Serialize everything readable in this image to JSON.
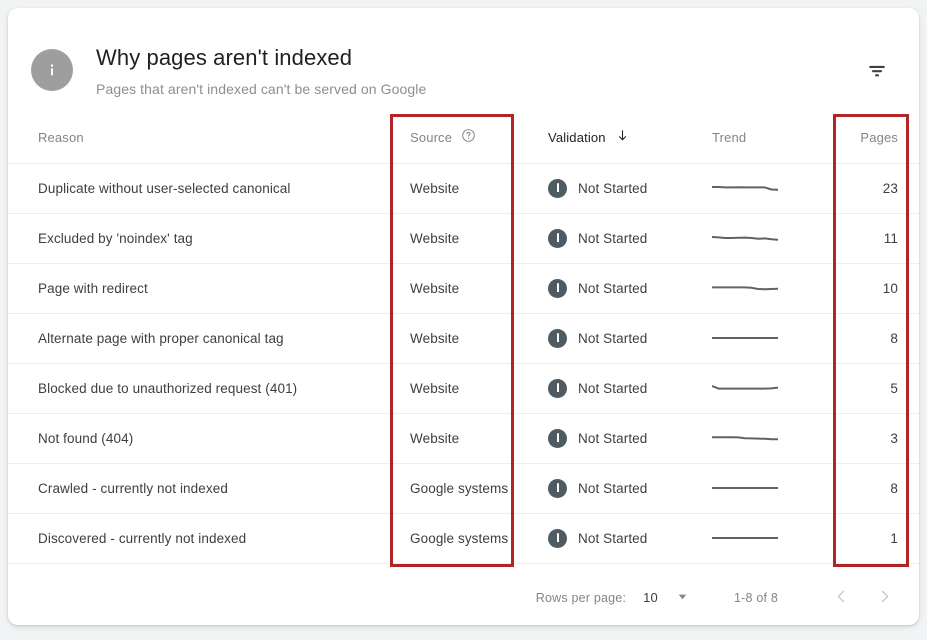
{
  "header": {
    "title": "Why pages aren't indexed",
    "subtitle": "Pages that aren't indexed can't be served on Google",
    "info_icon": "info-icon",
    "filter_icon": "filter-icon"
  },
  "table": {
    "columns": [
      {
        "key": "reason",
        "label": "Reason",
        "sorted": false,
        "help": false
      },
      {
        "key": "source",
        "label": "Source",
        "sorted": false,
        "help": true,
        "help_icon": "help-circle-icon"
      },
      {
        "key": "validation",
        "label": "Validation",
        "sorted": true,
        "sort_icon": "arrow-down-icon",
        "help": false
      },
      {
        "key": "trend",
        "label": "Trend",
        "sorted": false,
        "help": false
      },
      {
        "key": "pages",
        "label": "Pages",
        "sorted": false,
        "help": false
      }
    ],
    "rows": [
      {
        "reason": "Duplicate without user-selected canonical",
        "source": "Website",
        "validation": "Not Started",
        "status_icon": "alert-icon",
        "pages": "23",
        "trend": [
          12,
          12,
          11.6,
          11.6,
          11.7,
          11.6,
          11.6,
          11.6,
          11.6,
          9.5,
          9.3
        ]
      },
      {
        "reason": "Excluded by 'noindex' tag",
        "source": "Website",
        "validation": "Not Started",
        "status_icon": "alert-icon",
        "pages": "11",
        "trend": [
          12,
          11.6,
          11,
          11,
          11.2,
          11.4,
          11,
          10.2,
          10.6,
          9.8,
          9.2
        ]
      },
      {
        "reason": "Page with redirect",
        "source": "Website",
        "validation": "Not Started",
        "status_icon": "alert-icon",
        "pages": "10",
        "trend": [
          11.6,
          11.6,
          11.6,
          11.6,
          11.6,
          11.6,
          11.2,
          10,
          9.8,
          10,
          10.2
        ]
      },
      {
        "reason": "Alternate page with proper canonical tag",
        "source": "Website",
        "validation": "Not Started",
        "status_icon": "alert-icon",
        "pages": "8",
        "trend": [
          11,
          11,
          11,
          11,
          11,
          11,
          11,
          11,
          11,
          11,
          11
        ]
      },
      {
        "reason": "Blocked due to unauthorized request (401)",
        "source": "Website",
        "validation": "Not Started",
        "status_icon": "alert-icon",
        "pages": "5",
        "trend": [
          13,
          10.4,
          10.4,
          10.4,
          10.4,
          10.4,
          10.4,
          10.4,
          10.4,
          10.6,
          11.4
        ]
      },
      {
        "reason": "Not found (404)",
        "source": "Website",
        "validation": "Not Started",
        "status_icon": "alert-icon",
        "pages": "3",
        "trend": [
          11.8,
          11.8,
          11.8,
          11.8,
          11.6,
          10.8,
          10.6,
          10.4,
          10.2,
          9.8,
          9.8
        ]
      },
      {
        "reason": "Crawled - currently not indexed",
        "source": "Google systems",
        "validation": "Not Started",
        "status_icon": "alert-icon",
        "pages": "8",
        "trend": [
          11,
          11,
          11,
          11,
          11,
          11,
          11,
          11,
          11,
          11,
          11
        ]
      },
      {
        "reason": "Discovered - currently not indexed",
        "source": "Google systems",
        "validation": "Not Started",
        "status_icon": "alert-icon",
        "pages": "1",
        "trend": [
          11,
          11,
          11,
          11,
          11,
          11,
          11,
          11,
          11,
          11,
          11
        ]
      }
    ]
  },
  "footer": {
    "rows_per_page_label": "Rows per page:",
    "rows_per_page_value": "10",
    "dropdown_icon": "chevron-down-icon",
    "page_range": "1-8 of 8",
    "prev_icon": "chevron-left-icon",
    "next_icon": "chevron-right-icon"
  },
  "annotations": {
    "source_box": "highlight-source-column",
    "pages_box": "highlight-pages-column",
    "color": "#b32525"
  }
}
